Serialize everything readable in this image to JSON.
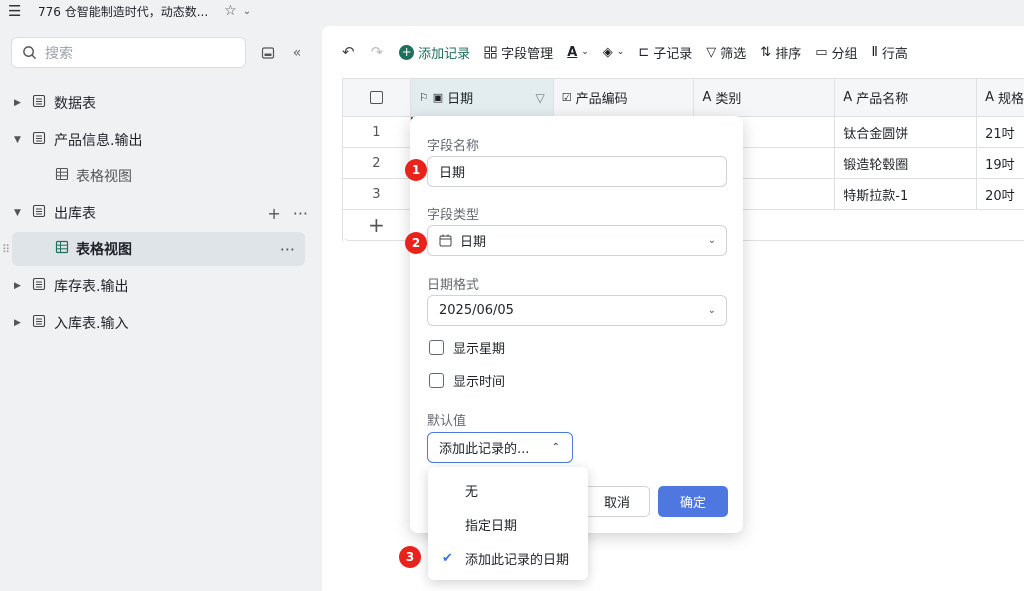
{
  "window": {
    "title": "776 仓智能制造时代，动态数..."
  },
  "sidebar": {
    "search_placeholder": "搜索",
    "items": [
      {
        "label": "数据表"
      },
      {
        "label": "产品信息.输出"
      },
      {
        "label": "表格视图"
      },
      {
        "label": "出库表"
      },
      {
        "label": "表格视图"
      },
      {
        "label": "库存表.输出"
      },
      {
        "label": "入库表.输入"
      }
    ]
  },
  "toolbar": {
    "add_record": "添加记录",
    "field_manage": "字段管理",
    "sub_record": "子记录",
    "filter": "筛选",
    "sort": "排序",
    "group": "分组",
    "row_height": "行高"
  },
  "grid": {
    "columns": [
      "日期",
      "产品编码",
      "类别",
      "产品名称",
      "规格"
    ],
    "rows": [
      {
        "num": "1",
        "product_name": "钛合金圆饼",
        "spec": "21吋"
      },
      {
        "num": "2",
        "product_name": "锻造轮毂圈",
        "spec": "19吋"
      },
      {
        "num": "3",
        "product_name": "特斯拉款-1",
        "spec": "20吋"
      }
    ]
  },
  "field_popup": {
    "name_label": "字段名称",
    "name_value": "日期",
    "type_label": "字段类型",
    "type_value": "日期",
    "format_label": "日期格式",
    "format_value": "2025/06/05",
    "show_weekday": "显示星期",
    "show_time": "显示时间",
    "default_label": "默认值",
    "default_value": "添加此记录的...",
    "cancel": "取消",
    "confirm": "确定"
  },
  "default_dropdown": {
    "options": [
      "无",
      "指定日期",
      "添加此记录的日期"
    ],
    "selected": "添加此记录的日期"
  },
  "badges": [
    "1",
    "2",
    "3"
  ],
  "colors": {
    "accent": "#4e78e0",
    "brand_green": "#1f6f5c",
    "badge_red": "#e8231b"
  }
}
